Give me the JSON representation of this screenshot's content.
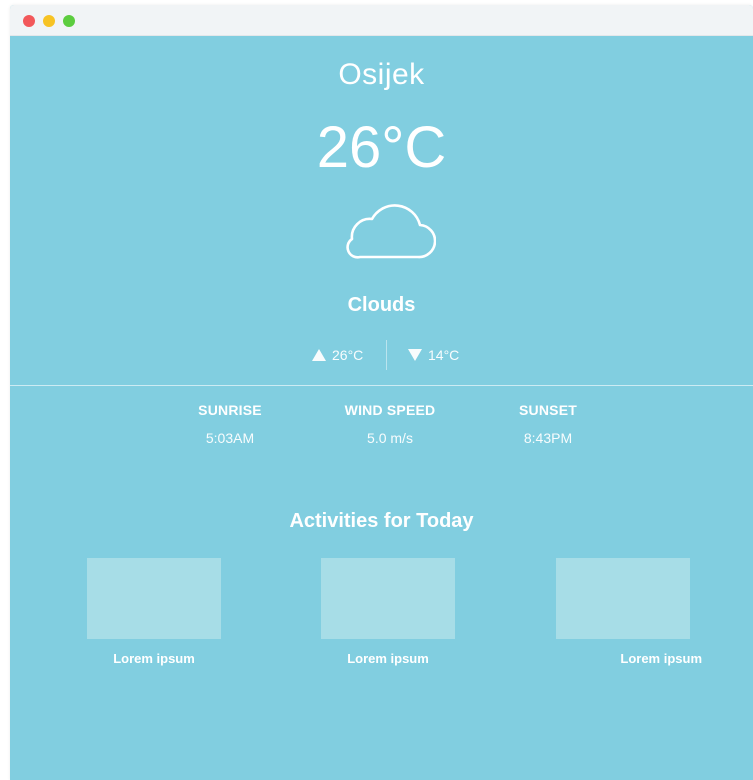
{
  "window": {
    "controls": [
      "close",
      "minimize",
      "maximize"
    ],
    "colors": {
      "close": "#f2585a",
      "minimize": "#f7c324",
      "maximize": "#5ccd3f"
    }
  },
  "weather": {
    "city": "Osijek",
    "temperature": "26°C",
    "condition_icon": "cloud-icon",
    "condition": "Clouds",
    "high": "26°C",
    "low": "14°C"
  },
  "stats": {
    "sunrise_label": "SUNRISE",
    "sunrise_value": "5:03AM",
    "wind_label": "WIND SPEED",
    "wind_value": "5.0 m/s",
    "sunset_label": "SUNSET",
    "sunset_value": "8:43PM"
  },
  "activities": {
    "title": "Activities for Today",
    "items": [
      {
        "label": "Lorem ipsum"
      },
      {
        "label": "Lorem ipsum"
      },
      {
        "label": "Lorem ipsum"
      }
    ]
  },
  "theme": {
    "background": "#81cee0",
    "thumbnail": "#a7dde7",
    "text": "#ffffff"
  }
}
